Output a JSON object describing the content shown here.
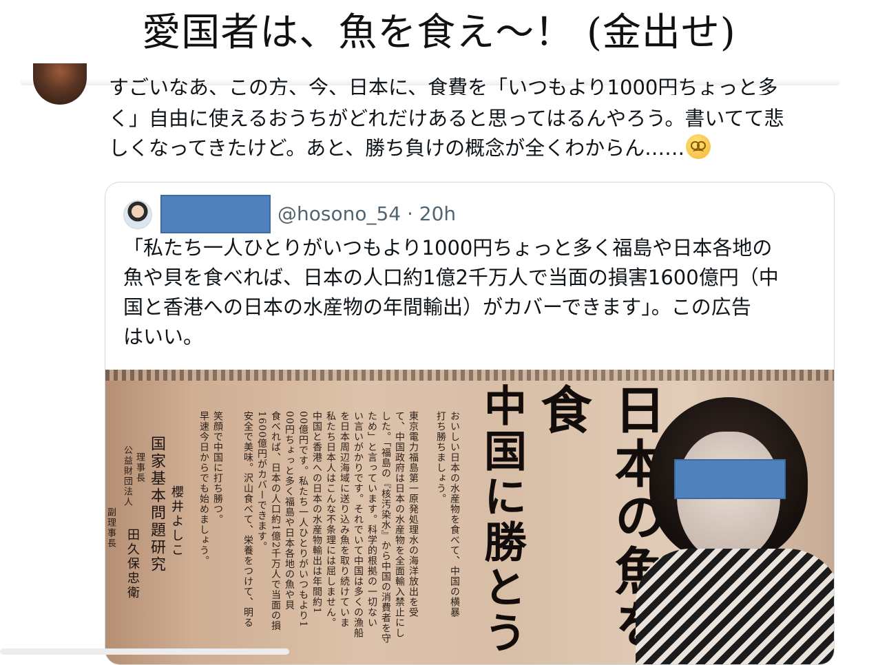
{
  "headline": "愛国者は、魚を食え～！ (金出せ)",
  "tweet": {
    "line1": "すごいなあ、この方、今、日本に、食費を「いつもより1000円ちょっと多",
    "line2": "く」自由に使えるおうちがどれだけあると思ってはるんやろう。書いてて悲",
    "line3": "しくなってきたけど。あと、勝ち負けの概念が全くわからん……",
    "emoji": "woozy-face-icon"
  },
  "quote": {
    "handle": "@hosono_54 · 20h",
    "lines": [
      "「私たち一人ひとりがいつもより1000円ちょっと多く福島や日本各地の",
      "魚や貝を食べれば、日本の人口約1億2千万人で当面の損害1600億円（中",
      "国と香港への日本の水産物の年間輸出）がカバーできます」。この広告",
      "はいい。"
    ]
  },
  "newspaper": {
    "title_col1": "日本の魚を食",
    "title_col2": "中国に勝とう",
    "body_cols": [
      "おいしい日本の水産物を食べて、中国の横暴",
      "打ち勝ちましょう。",
      "東京電力福島第一原発処理水の海洋放出を受",
      "て、中国政府は日本の水産物を全面輸入禁止にし",
      "した。「福島の『核汚染水』から中国の消費者を守",
      "ため」と言っています。科学的根拠の一切ない",
      "い言いがかりです。それでいて中国は多くの漁船",
      "を日本周辺海域に送り込み魚を取り続けていま",
      "私たち日本人はこんな不条理には屈しません。",
      "中国と香港への日本の水産物輸出は年間約1",
      "00億円です。私たち一人ひとりがいつもより1",
      "00円ちょっと多く福島や日本各地の魚や貝",
      "食べれば、日本の人口約1億2千万人で当面の損",
      "1600億円がカバーできます。",
      "安全で美味。沢山食べて、栄養をつけて、明る",
      "笑顔で中国に打ち勝つ。",
      "早速今日からでも始めましょう。"
    ],
    "org_label": "公益財団法人",
    "org_name": "国家基本問題研究",
    "role1": "理事長",
    "person1": "櫻井よしこ",
    "role2": "副理事長",
    "person2": "田久保忠衛"
  }
}
